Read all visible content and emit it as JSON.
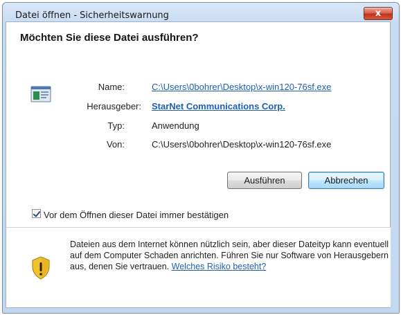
{
  "window": {
    "title": "Datei öffnen - Sicherheitswarnung",
    "close_label": "x"
  },
  "question": "Möchten Sie diese Datei ausführen?",
  "details": {
    "name_label": "Name:",
    "name_value": "C:\\Users\\0bohrer\\Desktop\\x-win120-76sf.exe",
    "publisher_label": "Herausgeber:",
    "publisher_value": "StarNet Communications Corp.",
    "type_label": "Typ:",
    "type_value": "Anwendung",
    "from_label": "Von:",
    "from_value": "C:\\Users\\0bohrer\\Desktop\\x-win120-76sf.exe"
  },
  "buttons": {
    "run": "Ausführen",
    "cancel": "Abbrechen"
  },
  "checkbox": {
    "checked": true,
    "label": "Vor dem Öffnen dieser Datei immer bestätigen"
  },
  "warning": {
    "text": "Dateien aus dem Internet können nützlich sein, aber dieser Dateityp kann eventuell auf dem Computer Schaden anrichten. Führen Sie nur Software von Herausgebern aus, denen Sie vertrauen.",
    "link": "Welches Risiko besteht?"
  },
  "colors": {
    "link": "#1f5fb2",
    "shield_yellow": "#f2c12e"
  }
}
